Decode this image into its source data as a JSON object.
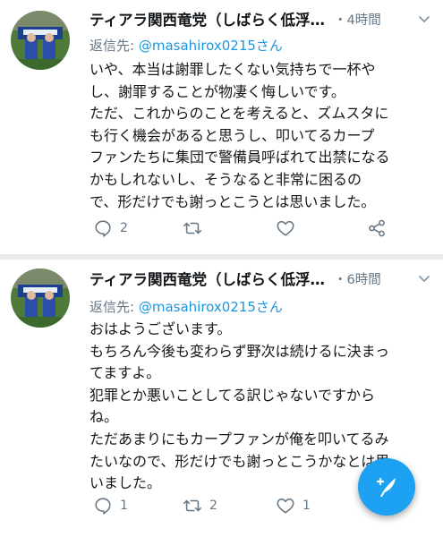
{
  "colors": {
    "accent": "#1da1f2",
    "link": "#1b95e0",
    "secondary_text": "#657786",
    "divider_background": "#e9ecef"
  },
  "tweets": [
    {
      "author_name": "ティアラ関西竜党（しばらく低浮…",
      "timestamp": "・4時間",
      "reply_prefix": "返信先: ",
      "reply_handle": "@masahirox0215さん",
      "lines": [
        "いや、本当は謝罪したくない気持ちで一杯や",
        "し、謝罪することが物凄く悔しいです。",
        "ただ、これからのことを考えると、ズムスタに",
        "も行く機会があると思うし、叩いてるカープ",
        "ファンたちに集団で警備員呼ばれて出禁になる",
        "かもしれないし、そうなると非常に困るの",
        "で、形だけでも謝っとこうとは思いました。"
      ],
      "reply_count": "2",
      "retweet_count": "",
      "like_count": ""
    },
    {
      "author_name": "ティアラ関西竜党（しばらく低浮…",
      "timestamp": "・6時間",
      "reply_prefix": "返信先: ",
      "reply_handle": "@masahirox0215さん",
      "lines": [
        "おはようございます。",
        "もちろん今後も変わらず野次は続けるに決まっ",
        "てますよ。",
        "犯罪とか悪いことしてる訳じゃないですから",
        "ね。",
        "ただあまりにもカープファンが俺を叩いてるみ",
        "たいなので、形だけでも謝っとこうかなとは思",
        "いました。"
      ],
      "reply_count": "1",
      "retweet_count": "2",
      "like_count": "1"
    }
  ],
  "icons": {
    "reply": "reply-icon",
    "retweet": "retweet-icon",
    "like": "heart-icon",
    "share": "share-icon",
    "caret": "chevron-down-icon",
    "compose": "compose-tweet-icon"
  }
}
